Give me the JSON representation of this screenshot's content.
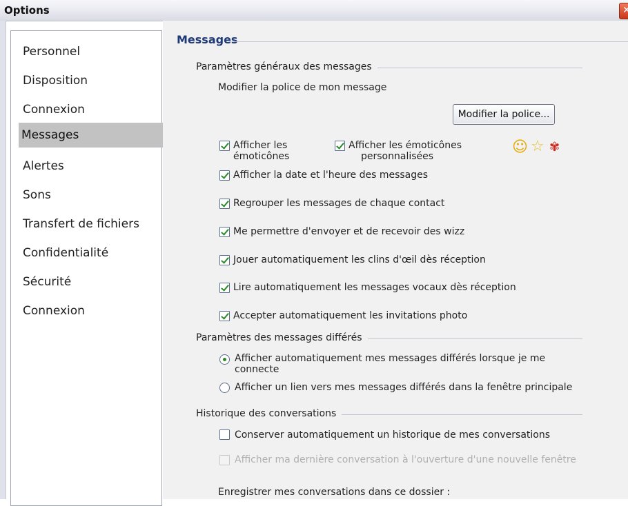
{
  "window": {
    "title": "Options",
    "close_glyph": "✕"
  },
  "sidebar": {
    "items": [
      {
        "label": "Personnel",
        "selected": false
      },
      {
        "label": "Disposition",
        "selected": false
      },
      {
        "label": "Connexion",
        "selected": false
      },
      {
        "label": "Messages",
        "selected": true
      },
      {
        "label": "Alertes",
        "selected": false
      },
      {
        "label": "Sons",
        "selected": false
      },
      {
        "label": "Transfert de fichiers",
        "selected": false
      },
      {
        "label": "Confidentialité",
        "selected": false
      },
      {
        "label": "Sécurité",
        "selected": false
      },
      {
        "label": "Connexion",
        "selected": false
      }
    ]
  },
  "main": {
    "title": "Messages",
    "general": {
      "header": "Paramètres généraux des messages",
      "font_label": "Modifier la police de mon message",
      "font_button": "Modifier la police...",
      "emoticons_line1": "Afficher les",
      "emoticons_line2": "émoticônes",
      "custom_emoticons_line1": "Afficher les émoticônes",
      "custom_emoticons_line2": "personnalisées",
      "icons": {
        "smiley": "smiley-icon",
        "star": "star-icon",
        "rose": "rose-icon"
      },
      "options": [
        {
          "label": "Afficher la date et l'heure des messages",
          "checked": true
        },
        {
          "label": "Regrouper les messages de chaque contact",
          "checked": true
        },
        {
          "label": "Me permettre d'envoyer et de recevoir des wizz",
          "checked": true
        },
        {
          "label": "Jouer automatiquement les clins d'œil dès réception",
          "checked": true
        },
        {
          "label": "Lire automatiquement les messages vocaux dès réception",
          "checked": true
        },
        {
          "label": "Accepter automatiquement les invitations photo",
          "checked": true
        }
      ]
    },
    "deferred": {
      "header": "Paramètres des messages différés",
      "radio1_line1": "Afficher automatiquement mes messages différés lorsque je me",
      "radio1_line2": "connecte",
      "radio2": "Afficher un lien vers mes messages différés dans la fenêtre principale",
      "selected_option": 1
    },
    "history": {
      "header": "Historique des conversations",
      "keep_history": "Conserver automatiquement un historique de mes conversations",
      "show_last": "Afficher ma dernière conversation à l'ouverture d'une nouvelle fenêtre",
      "save_folder_label": "Enregistrer mes conversations dans ce dossier :"
    }
  },
  "colors": {
    "section_title": "#1f3a78",
    "check": "#2a8a2a",
    "selection": "#c2c2c2"
  }
}
